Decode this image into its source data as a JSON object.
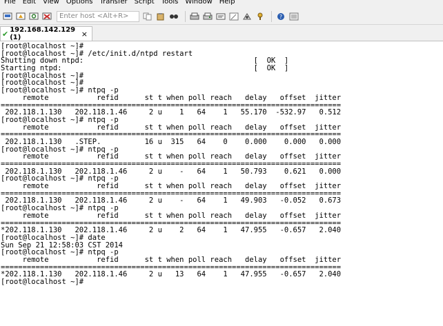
{
  "menu": [
    "File",
    "Edit",
    "View",
    "Options",
    "Transfer",
    "Script",
    "Tools",
    "Window",
    "Help"
  ],
  "toolbar": {
    "host_placeholder": "Enter host <Alt+R>",
    "icons": [
      "connect-icon",
      "quick-connect-icon",
      "reconnect-icon",
      "disconnect-icon",
      "copy-icon",
      "paste-icon",
      "find-icon",
      "print-icon",
      "print-setup-icon",
      "session-options-icon",
      "settings-icon",
      "sftp-icon",
      "keymap-icon",
      "help-icon",
      "screen-icon"
    ]
  },
  "tab": {
    "title": "192.168.142.129 (1)",
    "close": "×"
  },
  "terminal": {
    "lines": [
      "[root@localhost ~]#",
      "[root@localhost ~]# /etc/init.d/ntpd restart",
      "Shutting down ntpd:                                       [  OK  ]",
      "Starting ntpd:                                            [  OK  ]",
      "[root@localhost ~]#",
      "[root@localhost ~]#",
      "[root@localhost ~]# ntpq -p",
      "     remote           refid      st t when poll reach   delay   offset  jitter",
      "==============================================================================",
      " 202.118.1.130   202.118.1.46     2 u    1   64    1   55.170  -532.97   0.512",
      "[root@localhost ~]# ntpq -p",
      "     remote           refid      st t when poll reach   delay   offset  jitter",
      "==============================================================================",
      " 202.118.1.130   .STEP.          16 u  315   64    0    0.000    0.000   0.000",
      "[root@localhost ~]# ntpq -p",
      "     remote           refid      st t when poll reach   delay   offset  jitter",
      "==============================================================================",
      " 202.118.1.130   202.118.1.46     2 u    -   64    1   50.793    0.621   0.000",
      "[root@localhost ~]# ntpq -p",
      "     remote           refid      st t when poll reach   delay   offset  jitter",
      "==============================================================================",
      " 202.118.1.130   202.118.1.46     2 u    -   64    1   49.903   -0.052   0.673",
      "[root@localhost ~]# ntpq -p",
      "     remote           refid      st t when poll reach   delay   offset  jitter",
      "==============================================================================",
      "*202.118.1.130   202.118.1.46     2 u    2   64    1   47.955   -0.657   2.040",
      "[root@localhost ~]# date",
      "Sun Sep 21 12:58:03 CST 2014",
      "[root@localhost ~]# ntpq -p",
      "     remote           refid      st t when poll reach   delay   offset  jitter",
      "==============================================================================",
      "*202.118.1.130   202.118.1.46     2 u   13   64    1   47.955   -0.657   2.040",
      "[root@localhost ~]#"
    ]
  }
}
